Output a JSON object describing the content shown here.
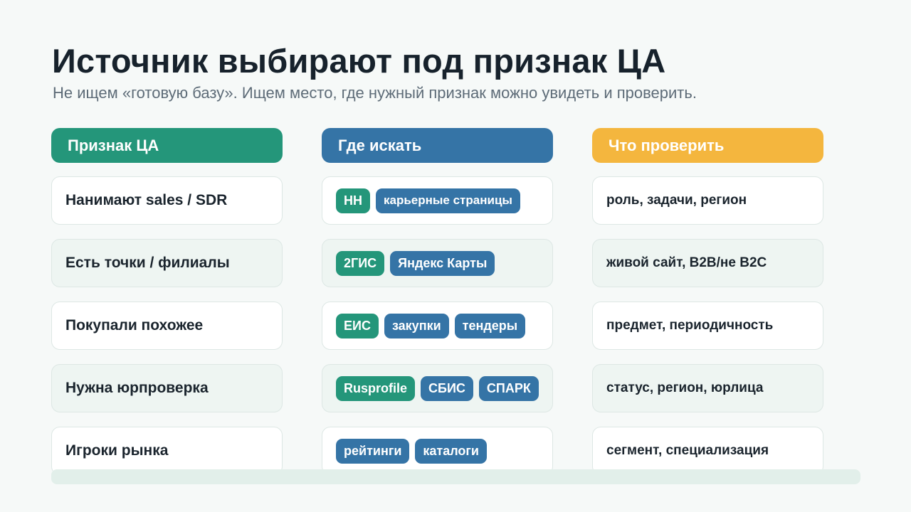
{
  "slide": {
    "title": "Источник выбирают под признак ЦА",
    "subtitle": "Не ищем «готовую базу». Ищем место, где нужный признак можно увидеть и проверить."
  },
  "columns": {
    "trait": {
      "label": "Признак ЦА",
      "color": "#24967a"
    },
    "where": {
      "label": "Где искать",
      "color": "#3574a6"
    },
    "check": {
      "label": "Что проверить",
      "color": "#f4b63e"
    }
  },
  "rows": [
    {
      "trait": "Нанимают sales / SDR",
      "where": [
        {
          "label": "HH",
          "color": "green"
        },
        {
          "label": "карьерные страницы",
          "color": "blue"
        }
      ],
      "check": "роль, задачи, регион"
    },
    {
      "trait": "Есть точки / филиалы",
      "where": [
        {
          "label": "2ГИС",
          "color": "green"
        },
        {
          "label": "Яндекс Карты",
          "color": "blue"
        }
      ],
      "check": "живой сайт, B2B/не B2C"
    },
    {
      "trait": "Покупали похожее",
      "where": [
        {
          "label": "ЕИС",
          "color": "green"
        },
        {
          "label": "закупки",
          "color": "blue"
        },
        {
          "label": "тендеры",
          "color": "blue"
        }
      ],
      "check": "предмет, периодичность"
    },
    {
      "trait": "Нужна юрпроверка",
      "where": [
        {
          "label": "Rusprofile",
          "color": "green"
        },
        {
          "label": "СБИС",
          "color": "blue"
        },
        {
          "label": "СПАРК",
          "color": "blue"
        }
      ],
      "check": "статус, регион, юрлица"
    },
    {
      "trait": "Игроки рынка",
      "where": [
        {
          "label": "рейтинги",
          "color": "blue"
        },
        {
          "label": "каталоги",
          "color": "blue"
        }
      ],
      "check": "сегмент, специализация"
    }
  ]
}
